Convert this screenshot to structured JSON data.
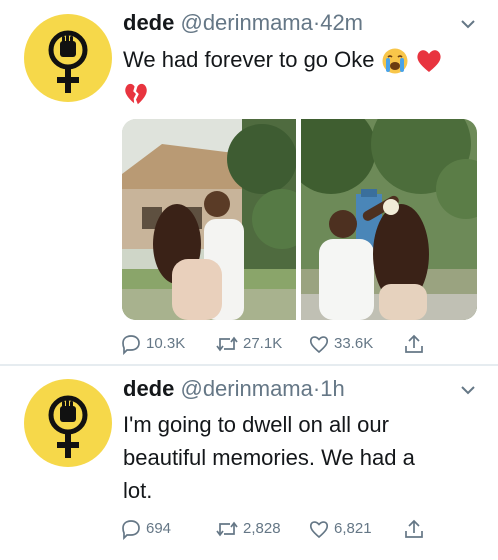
{
  "tweets": [
    {
      "name": "dede",
      "handle": "@derinmama",
      "separator": "·",
      "time": "42m",
      "text": "We had forever to go Oke",
      "emojis": [
        "crying-face",
        "red-heart",
        "broken-heart"
      ],
      "replies": "10.3K",
      "retweets": "27.1K",
      "likes": "33.6K"
    },
    {
      "name": "dede",
      "handle": "@derinmama",
      "separator": "·",
      "time": "1h",
      "text_lines": [
        "I'm going to dwell on all our",
        "beautiful memories. We had a",
        "lot."
      ],
      "replies": "694",
      "retweets": "2,828",
      "likes": "6,821"
    }
  ],
  "colors": {
    "avatar_bg": "#f6d84a",
    "text": "#14171a",
    "muted": "#657786",
    "divider": "#e6ecf0"
  },
  "icons": {
    "avatar": "female-fist-symbol-icon",
    "more": "chevron-down-icon",
    "reply": "reply-icon",
    "retweet": "retweet-icon",
    "like": "heart-icon",
    "share": "share-icon"
  }
}
